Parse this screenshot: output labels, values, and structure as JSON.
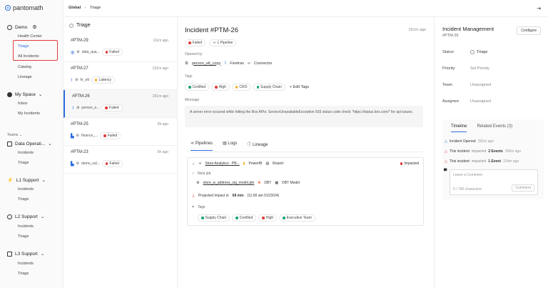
{
  "brand": {
    "name": "pantomath"
  },
  "breadcrumb": {
    "root": "Global",
    "sep": "›",
    "current": "Triage"
  },
  "sidebar": {
    "groups": [
      {
        "label": "Demo",
        "items": [
          "Health Center",
          "Triage",
          "All Incidents",
          "Catalog",
          "Lineage"
        ]
      },
      {
        "label": "My Space",
        "items": [
          "Inbox",
          "My Incidents"
        ]
      }
    ],
    "teams_label": "Teams",
    "teams": [
      {
        "label": "Data Operati...",
        "items": [
          "Incidents",
          "Triage"
        ]
      },
      {
        "label": "L1 Support",
        "items": [
          "Incidents",
          "Triage"
        ]
      },
      {
        "label": "L2 Support",
        "items": [
          "Incidents",
          "Triage"
        ]
      },
      {
        "label": "L3 Support",
        "items": [
          "Incidents",
          "Triage"
        ]
      }
    ]
  },
  "list": {
    "title": "Triage",
    "items": [
      {
        "id": "#PTM-29",
        "age": "111m ago",
        "name": "data_qua...",
        "status": "Failed",
        "status_color": "#e03b3b"
      },
      {
        "id": "#PTM-27",
        "age": "231m ago",
        "name": "hr_etl",
        "status": "Latency",
        "status_color": "#f0b429"
      },
      {
        "id": "#PTM-26",
        "age": "291m ago",
        "name": "person_e...",
        "status": "Failed",
        "status_color": "#e03b3b"
      },
      {
        "id": "#PTM-25",
        "age": "5h ago",
        "name": "finance_...",
        "status": "Failed",
        "status_color": "#e03b3b"
      },
      {
        "id": "#PTM-23",
        "age": "6h ago",
        "name": "demo_sal...",
        "status": "Failed",
        "status_color": "#e03b3b"
      }
    ]
  },
  "incident": {
    "title": "Incident #PTM-26",
    "age": "291m ago",
    "status": "Failed",
    "pipelines": "1 Pipeline",
    "opened_by_label": "Opened by",
    "opened_by": {
      "job": "person_etl_copy",
      "source": "Fivetran",
      "type": "Connector"
    },
    "tags_label": "Tags",
    "tags": [
      "Certified",
      "High",
      "CRO",
      "Supply Chain"
    ],
    "edit_tags": "+ Edit Tags",
    "message_label": "Message",
    "message": "A server error occured while hitting the Box APIs: ServiceUnavailableException 503 status code check \"https://status.box.com/\" for api issues.",
    "tabs": [
      "Pipelines",
      "Logs",
      "Lineage"
    ],
    "pipeline": {
      "name": "Store Analytics - PB...",
      "tool": "PowerBI",
      "type": "Report",
      "state": "Impacted",
      "next_job_label": "Next job",
      "next_job": "store_w_address_sig_model.pbi",
      "next_tool": "DBT",
      "next_type": "DBT Model",
      "impact_prefix": "Projected Impact in",
      "impact_value": "68 min",
      "impact_time": "(11:00 am 01/23/24)",
      "tags_label": "Tags",
      "tags": [
        "Supply Chain",
        "Certified",
        "High",
        "Executive Team"
      ]
    }
  },
  "mgmt": {
    "title": "Incident Management",
    "id": "#PTM-26",
    "configure": "Configure",
    "fields": [
      {
        "label": "Status:",
        "value": "Triage"
      },
      {
        "label": "Priority:",
        "value": "Set Priority"
      },
      {
        "label": "Team:",
        "value": "Unassigned"
      },
      {
        "label": "Assignee:",
        "value": "Unassigned"
      }
    ],
    "tabs": [
      "Timeline",
      "Related Events (3)"
    ],
    "events": [
      {
        "text": "Incident Opened",
        "time": "291m ago",
        "pre": "",
        "bold": ""
      },
      {
        "text": "impacted",
        "time": "290m ago",
        "pre": "This incident",
        "bold": "2 Events"
      },
      {
        "text": "impacted",
        "time": "224m ago",
        "pre": "This incident",
        "bold": "1 Event"
      }
    ],
    "comment_placeholder": "Leave a Comment",
    "comment_count": "0 / 740 characters",
    "comment_button": "Comment"
  }
}
